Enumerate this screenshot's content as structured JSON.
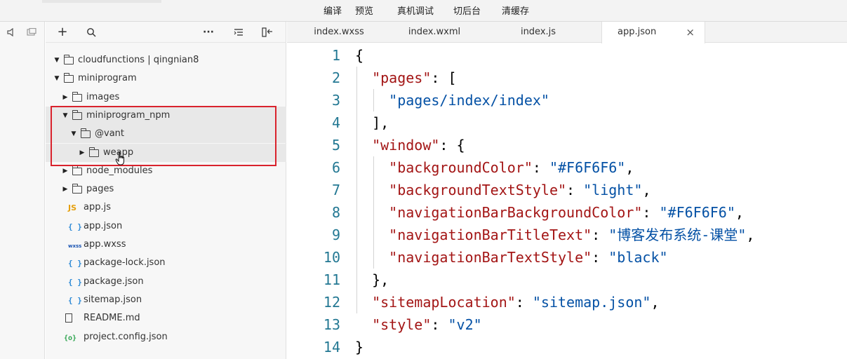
{
  "toolbar": {
    "items": [
      "编译",
      "预览",
      "真机调试",
      "切后台",
      "清缓存"
    ]
  },
  "explorer": {
    "tree": [
      {
        "label": "cloudfunctions | qingnian8",
        "kind": "cloud-folder",
        "expanded": true,
        "depth": 0
      },
      {
        "label": "miniprogram",
        "kind": "folder",
        "expanded": true,
        "depth": 0
      },
      {
        "label": "images",
        "kind": "folder",
        "expanded": false,
        "depth": 1
      },
      {
        "label": "miniprogram_npm",
        "kind": "folder",
        "expanded": true,
        "depth": 1
      },
      {
        "label": "@vant",
        "kind": "folder",
        "expanded": true,
        "depth": 2
      },
      {
        "label": "weapp",
        "kind": "folder",
        "expanded": false,
        "depth": 3
      },
      {
        "label": "node_modules",
        "kind": "folder",
        "expanded": false,
        "depth": 1
      },
      {
        "label": "pages",
        "kind": "folder",
        "expanded": false,
        "depth": 1
      },
      {
        "label": "app.js",
        "kind": "js",
        "depth": 1
      },
      {
        "label": "app.json",
        "kind": "json",
        "depth": 1
      },
      {
        "label": "app.wxss",
        "kind": "wxss",
        "depth": 1
      },
      {
        "label": "package-lock.json",
        "kind": "json",
        "depth": 1
      },
      {
        "label": "package.json",
        "kind": "json",
        "depth": 1
      },
      {
        "label": "sitemap.json",
        "kind": "json",
        "depth": 1
      },
      {
        "label": "README.md",
        "kind": "file",
        "depth": 0
      },
      {
        "label": "project.config.json",
        "kind": "config",
        "depth": 0
      }
    ],
    "icon_text": {
      "js": "JS",
      "json": "{ }",
      "wxss": "wxss",
      "config": "{o}"
    }
  },
  "editor": {
    "tabs": [
      {
        "label": "index.wxss",
        "active": false
      },
      {
        "label": "index.wxml",
        "active": false
      },
      {
        "label": "index.js",
        "active": false
      },
      {
        "label": "app.json",
        "active": true
      }
    ],
    "close_glyph": "×",
    "lines": [
      {
        "n": "1",
        "text": "{"
      },
      {
        "n": "2",
        "text": "  \"pages\": ["
      },
      {
        "n": "3",
        "text": "    \"pages/index/index\""
      },
      {
        "n": "4",
        "text": "  ],"
      },
      {
        "n": "5",
        "text": "  \"window\": {"
      },
      {
        "n": "6",
        "text": "    \"backgroundColor\": \"#F6F6F6\","
      },
      {
        "n": "7",
        "text": "    \"backgroundTextStyle\": \"light\","
      },
      {
        "n": "8",
        "text": "    \"navigationBarBackgroundColor\": \"#F6F6F6\","
      },
      {
        "n": "9",
        "text": "    \"navigationBarTitleText\": \"博客发布系统-课堂\","
      },
      {
        "n": "10",
        "text": "    \"navigationBarTextStyle\": \"black\""
      },
      {
        "n": "11",
        "text": "  },"
      },
      {
        "n": "12",
        "text": "  \"sitemapLocation\": \"sitemap.json\","
      },
      {
        "n": "13",
        "text": "  \"style\": \"v2\""
      },
      {
        "n": "14",
        "text": "}"
      }
    ]
  },
  "colors": {
    "key": "#a31515",
    "string": "#0451a5",
    "line_number": "#237893",
    "highlight_box": "#d9232d"
  }
}
